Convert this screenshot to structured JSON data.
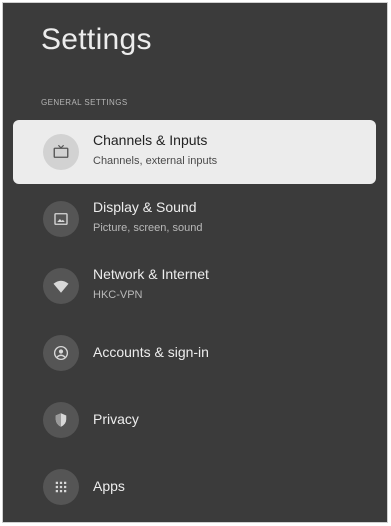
{
  "header": {
    "title": "Settings"
  },
  "section": {
    "label": "GENERAL SETTINGS"
  },
  "items": [
    {
      "label": "Channels & Inputs",
      "sub": "Channels, external inputs",
      "icon": "tv-icon",
      "selected": true
    },
    {
      "label": "Display & Sound",
      "sub": "Picture, screen, sound",
      "icon": "picture-icon"
    },
    {
      "label": "Network & Internet",
      "sub": "HKC-VPN",
      "icon": "wifi-icon"
    },
    {
      "label": "Accounts & sign-in",
      "icon": "account-icon"
    },
    {
      "label": "Privacy",
      "icon": "shield-icon"
    },
    {
      "label": "Apps",
      "icon": "apps-grid-icon"
    }
  ],
  "colors": {
    "background": "#3b3b3b",
    "selected_bg": "#ececec",
    "text": "#ededed"
  }
}
